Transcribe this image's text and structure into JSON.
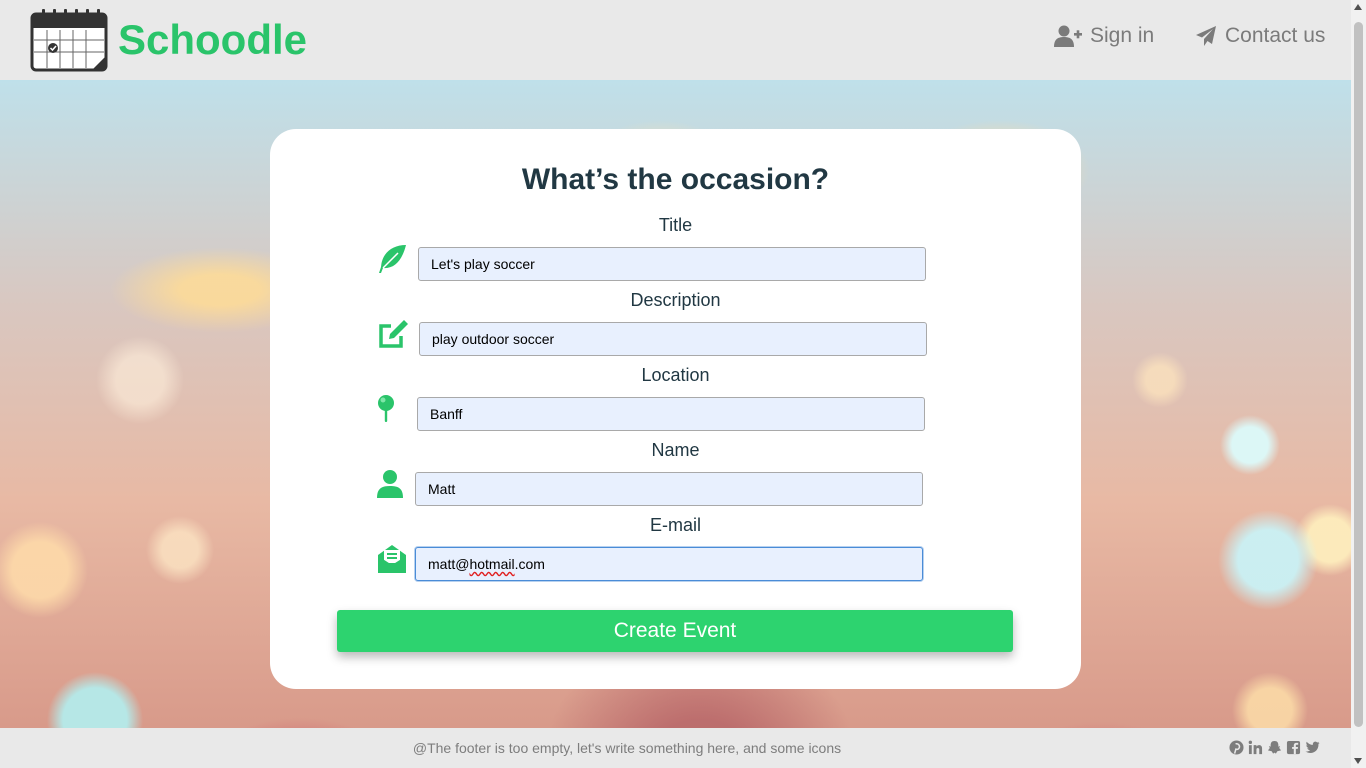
{
  "header": {
    "brand": "Schoodle",
    "nav": [
      {
        "label": "Sign in",
        "icon": "user-plus-icon"
      },
      {
        "label": "Contact us",
        "icon": "paper-plane-icon"
      }
    ]
  },
  "form": {
    "title": "What’s the occasion?",
    "fields": [
      {
        "label": "Title",
        "value": "Let's play soccer",
        "icon": "feather-icon"
      },
      {
        "label": "Description",
        "value": "play outdoor soccer",
        "icon": "edit-icon"
      },
      {
        "label": "Location",
        "value": "Banff",
        "icon": "map-pin-icon"
      },
      {
        "label": "Name",
        "value": "Matt",
        "icon": "user-icon"
      },
      {
        "label": "E-mail",
        "value_prefix": "matt@",
        "value_misspelled": "hotmail",
        "value_suffix": ".com",
        "icon": "envelope-open-icon"
      }
    ],
    "submit_label": "Create Event"
  },
  "footer": {
    "text": "@The footer is too empty, let's write something here, and some icons",
    "social_icons": [
      "pinterest-icon",
      "linkedin-icon",
      "snapchat-icon",
      "facebook-icon",
      "twitter-icon"
    ]
  },
  "colors": {
    "brand_green": "#2ac46a",
    "button_green": "#2dd36f",
    "input_bg": "#e8f0fe",
    "header_bg": "#e9e9e9",
    "nav_text": "#7b7b7b"
  }
}
